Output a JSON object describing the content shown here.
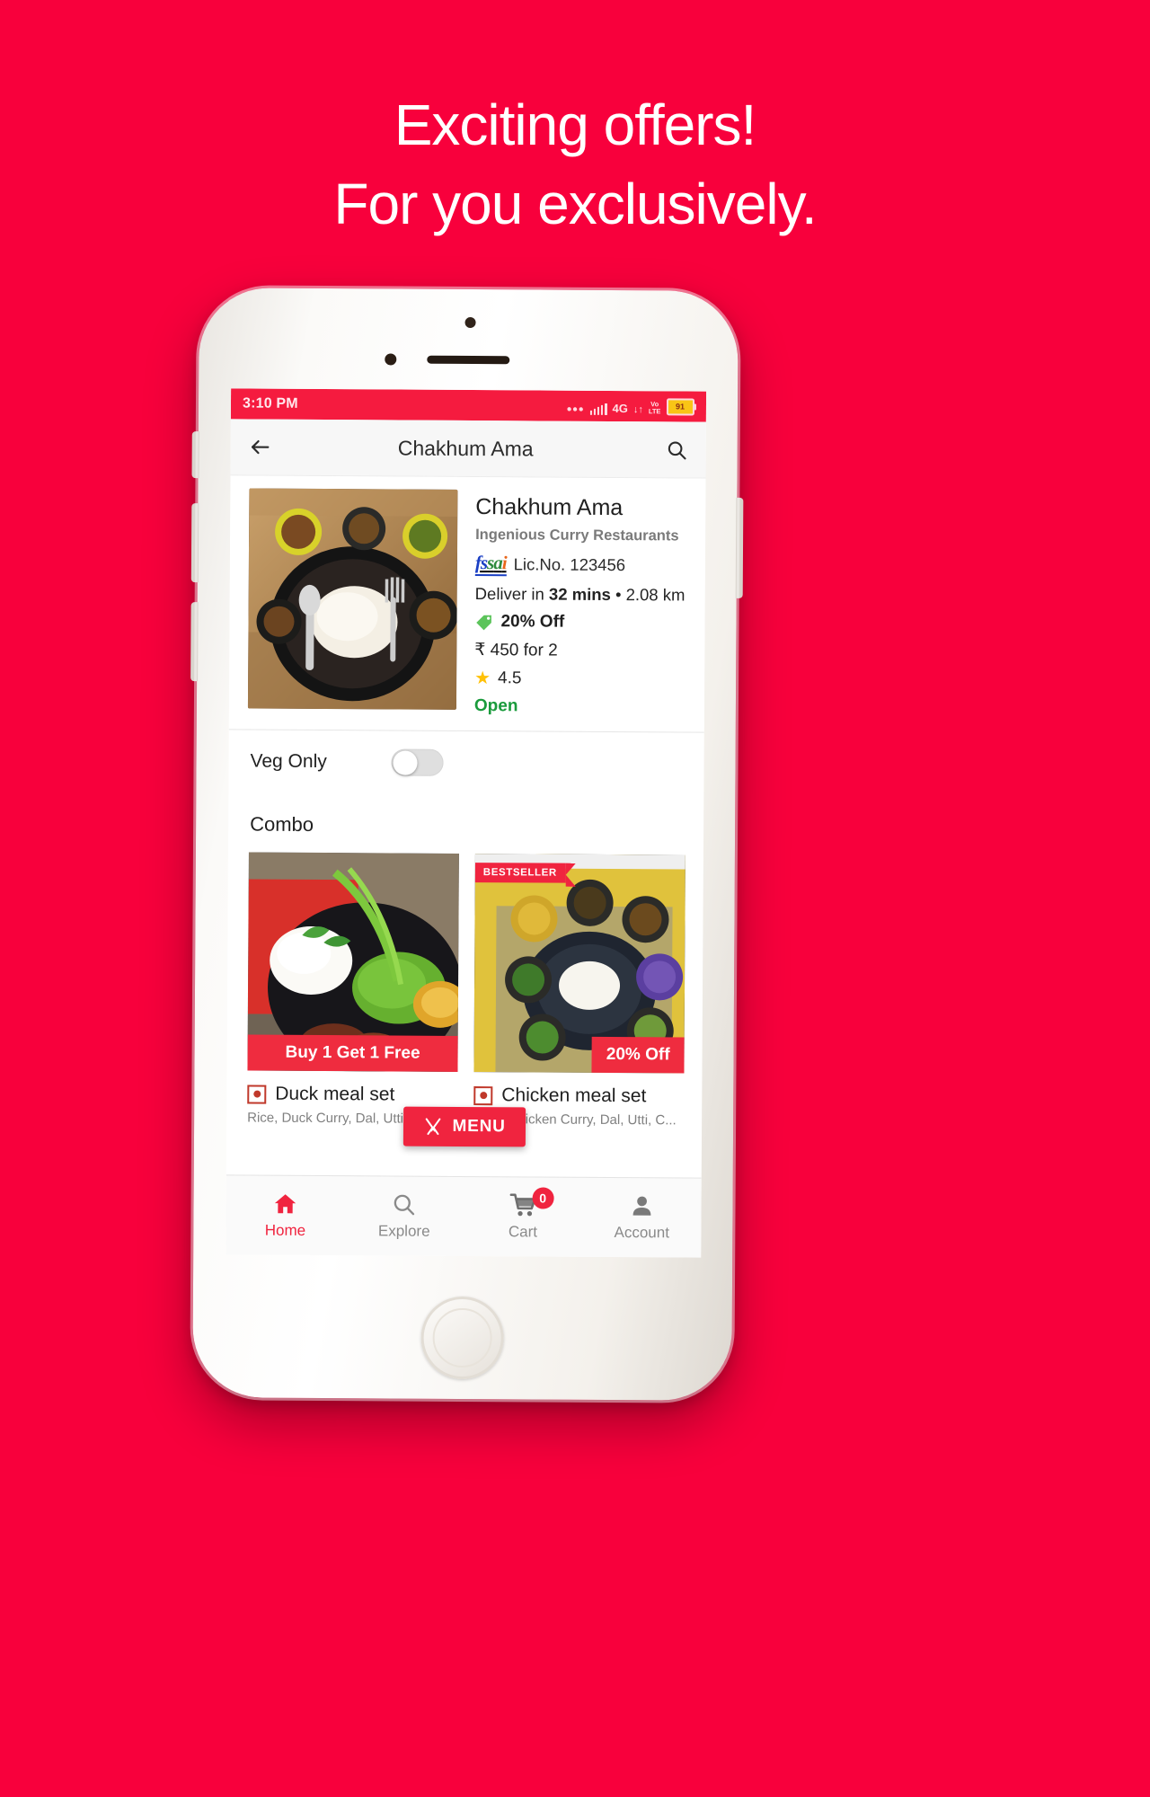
{
  "promo": {
    "line1": "Exciting offers!",
    "line2": "For you exclusively.",
    "background_color": "#F8003C",
    "text_color": "#FFFFFF"
  },
  "status_bar": {
    "time": "3:10 PM",
    "dots_icon": "more-dots-icon",
    "signal_icon": "signal-bars-icon",
    "network": "4G",
    "data_arrows": "↓↑",
    "volte": "VoLTE",
    "battery_level": "91",
    "background_color": "#F51B3F"
  },
  "app_bar": {
    "back_icon": "back-arrow-icon",
    "title": "Chakhum Ama",
    "search_icon": "search-icon"
  },
  "restaurant": {
    "image_alt": "thali-platter-photo",
    "name": "Chakhum Ama",
    "subtitle": "Ingenious Curry Restaurants",
    "fssai_logo": "fssai-logo",
    "license": "Lic.No. 123456",
    "delivery_prefix": "Deliver in ",
    "delivery_time": "32 mins",
    "delivery_suffix": " • 2.08 km",
    "offer_icon": "price-tag-icon",
    "offer": "20% Off",
    "price_for_two": "₹ 450 for 2",
    "rating_icon": "star-icon",
    "rating": "4.5",
    "status": "Open",
    "status_color": "#1A9B3C"
  },
  "veg_filter": {
    "label": "Veg Only",
    "toggle_name": "veg-only-toggle",
    "enabled": false
  },
  "combo_section": {
    "heading": "Combo",
    "items": [
      {
        "image_alt": "duck-meal-photo",
        "ribbon": "",
        "badge": "Buy 1 Get 1 Free",
        "veg_indicator": "non-veg-indicator",
        "title": "Duck meal set",
        "description": "Rice, Duck Curry, Dal, Utti, Chai..."
      },
      {
        "image_alt": "chicken-meal-photo",
        "ribbon": "BESTSELLER",
        "badge": "20% Off",
        "veg_indicator": "non-veg-indicator",
        "title": "Chicken meal set",
        "description": "Rice, Chicken Curry, Dal, Utti, C..."
      }
    ]
  },
  "menu_button": {
    "icon": "cutlery-icon",
    "label": "MENU",
    "color": "#F0243F"
  },
  "bottom_nav": {
    "items": [
      {
        "icon": "home-icon",
        "label": "Home",
        "active": true,
        "badge": null
      },
      {
        "icon": "search-icon",
        "label": "Explore",
        "active": false,
        "badge": null
      },
      {
        "icon": "cart-icon",
        "label": "Cart",
        "active": false,
        "badge": "0"
      },
      {
        "icon": "account-icon",
        "label": "Account",
        "active": false,
        "badge": null
      }
    ],
    "accent_color": "#F0243F"
  }
}
